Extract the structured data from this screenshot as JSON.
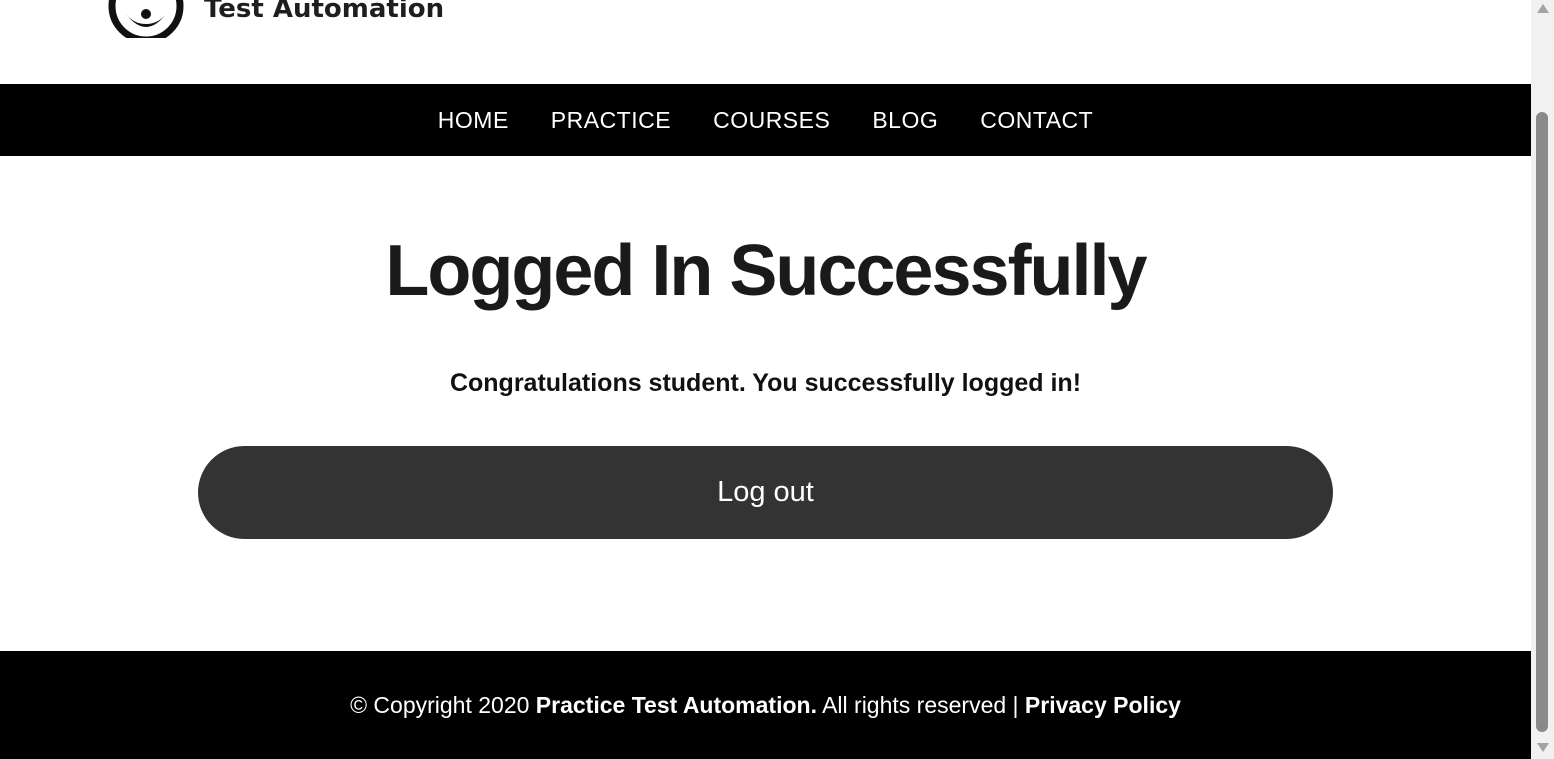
{
  "header": {
    "logo_text": "Test Automation"
  },
  "nav": {
    "items": [
      {
        "label": "HOME"
      },
      {
        "label": "PRACTICE"
      },
      {
        "label": "COURSES"
      },
      {
        "label": "BLOG"
      },
      {
        "label": "CONTACT"
      }
    ]
  },
  "main": {
    "title": "Logged In Successfully",
    "message": "Congratulations student. You successfully logged in!",
    "logout_label": "Log out"
  },
  "footer": {
    "copyright_prefix": "© Copyright 2020 ",
    "company": "Practice Test Automation.",
    "rights": " All rights reserved | ",
    "privacy_label": "Privacy Policy"
  },
  "colors": {
    "nav_bg": "#000000",
    "button_bg": "#333333",
    "footer_bg": "#000000",
    "text_dark": "#1a1a1a"
  }
}
